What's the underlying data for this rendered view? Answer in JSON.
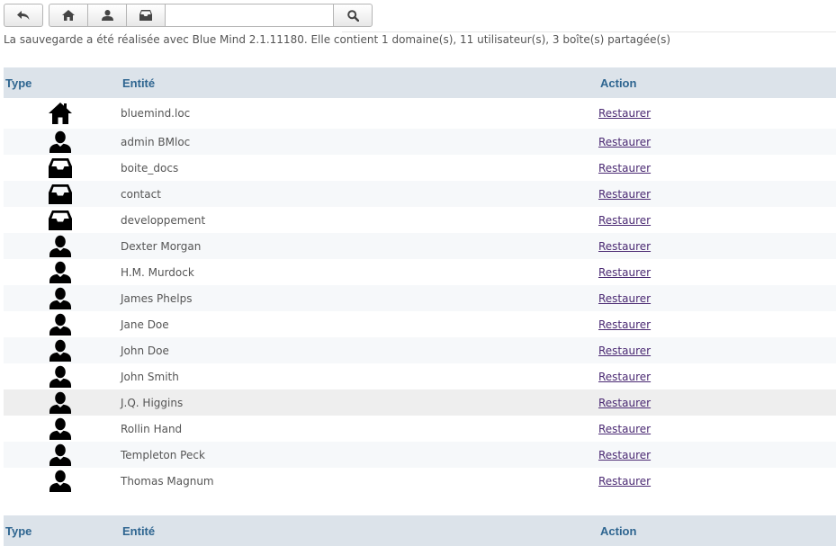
{
  "toolbar": {
    "back_icon": "back-arrow-icon",
    "home_icon": "home-icon",
    "user_icon": "user-icon",
    "mailbox_icon": "mailbox-icon",
    "search_value": "",
    "search_icon": "search-icon"
  },
  "summary": "La sauvegarde a été réalisée avec Blue Mind 2.1.11180. Elle contient 1 domaine(s), 11 utilisateur(s), 3 boîte(s) partagée(s)",
  "table": {
    "headers": {
      "type": "Type",
      "entity": "Entité",
      "action": "Action"
    },
    "rows": [
      {
        "type_icon": "home-icon",
        "entity": "bluemind.loc",
        "action": "Restaurer"
      },
      {
        "type_icon": "user-icon",
        "entity": "admin BMloc",
        "action": "Restaurer"
      },
      {
        "type_icon": "mailbox-icon",
        "entity": "boite_docs",
        "action": "Restaurer"
      },
      {
        "type_icon": "mailbox-icon",
        "entity": "contact",
        "action": "Restaurer"
      },
      {
        "type_icon": "mailbox-icon",
        "entity": "developpement",
        "action": "Restaurer"
      },
      {
        "type_icon": "user-icon",
        "entity": "Dexter Morgan",
        "action": "Restaurer"
      },
      {
        "type_icon": "user-icon",
        "entity": "H.M. Murdock",
        "action": "Restaurer"
      },
      {
        "type_icon": "user-icon",
        "entity": "James Phelps",
        "action": "Restaurer"
      },
      {
        "type_icon": "user-icon",
        "entity": "Jane Doe",
        "action": "Restaurer"
      },
      {
        "type_icon": "user-icon",
        "entity": "John Doe",
        "action": "Restaurer"
      },
      {
        "type_icon": "user-icon",
        "entity": "John Smith",
        "action": "Restaurer"
      },
      {
        "type_icon": "user-icon",
        "entity": "J.Q. Higgins",
        "action": "Restaurer"
      },
      {
        "type_icon": "user-icon",
        "entity": "Rollin Hand",
        "action": "Restaurer"
      },
      {
        "type_icon": "user-icon",
        "entity": "Templeton Peck",
        "action": "Restaurer"
      },
      {
        "type_icon": "user-icon",
        "entity": "Thomas Magnum",
        "action": "Restaurer"
      }
    ],
    "footer_headers": {
      "type": "Type",
      "entity": "Entité",
      "action": "Action"
    }
  },
  "colors": {
    "header_bg": "#dce3ea",
    "header_text": "#2e6590",
    "link": "#4b2a73",
    "alt_row": "#f6f8fa",
    "highlight_row": "#eeeeee"
  }
}
